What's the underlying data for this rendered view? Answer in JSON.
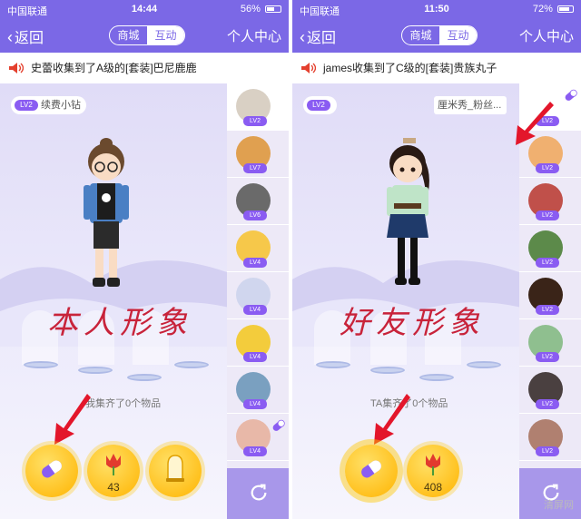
{
  "colors": {
    "brand": "#7b68e6",
    "caption": "#c8233a",
    "arrow": "#e3162b",
    "gold": "#ffb400",
    "level_badge": "#8a5cf2"
  },
  "left": {
    "status": {
      "carrier": "中国联通",
      "time": "14:44",
      "battery": "56%",
      "battery_level": 0.56
    },
    "nav": {
      "back": "返回",
      "tab_mall": "商城",
      "tab_interact": "互动",
      "right": "个人中心"
    },
    "ticker": "史蕾收集到了A级的[套装]巴尼鹿鹿",
    "tag_level": "LV2",
    "tag": "续费小钻",
    "caption": "本人形象",
    "collected": "我集齐了0个物品",
    "buttons": [
      {
        "icon": "pill-icon",
        "count": ""
      },
      {
        "icon": "tulip-icon",
        "count": "43"
      },
      {
        "icon": "bell-jar-icon",
        "count": ""
      }
    ],
    "friends": [
      {
        "level": "LV2",
        "face": "#d9d0c4"
      },
      {
        "level": "LV7",
        "face": "#e0a050"
      },
      {
        "level": "LV6",
        "face": "#6a6a6a"
      },
      {
        "level": "LV4",
        "face": "#f6c84a"
      },
      {
        "level": "LV4",
        "face": "#d0d6ee"
      },
      {
        "level": "LV4",
        "face": "#f3cc3c"
      },
      {
        "level": "LV4",
        "face": "#7aa0c0"
      },
      {
        "level": "LV4",
        "face": "#e8b8a8"
      }
    ]
  },
  "right": {
    "status": {
      "carrier": "中国联通",
      "time": "11:50",
      "battery": "72%",
      "battery_level": 0.72
    },
    "nav": {
      "back": "返回",
      "tab_mall": "商城",
      "tab_interact": "互动",
      "right": "个人中心"
    },
    "ticker": "james收集到了C级的[套装]贵族丸子",
    "tag_level": "LV2",
    "tag": "厘米秀_粉丝...",
    "caption": "好友形象",
    "collected": "TA集齐了0个物品",
    "buttons": [
      {
        "icon": "pill-icon",
        "count": ""
      },
      {
        "icon": "tulip-icon",
        "count": "408"
      }
    ],
    "friends": [
      {
        "level": "LV2",
        "face": "#ffffff"
      },
      {
        "level": "LV2",
        "face": "#f0b070"
      },
      {
        "level": "LV2",
        "face": "#c0504a"
      },
      {
        "level": "LV2",
        "face": "#5c8a4a"
      },
      {
        "level": "LV2",
        "face": "#3a2418"
      },
      {
        "level": "LV2",
        "face": "#8fbf8f"
      },
      {
        "level": "LV2",
        "face": "#4a4040"
      },
      {
        "level": "LV2",
        "face": "#b08070"
      }
    ]
  },
  "watermark": "清屏网"
}
